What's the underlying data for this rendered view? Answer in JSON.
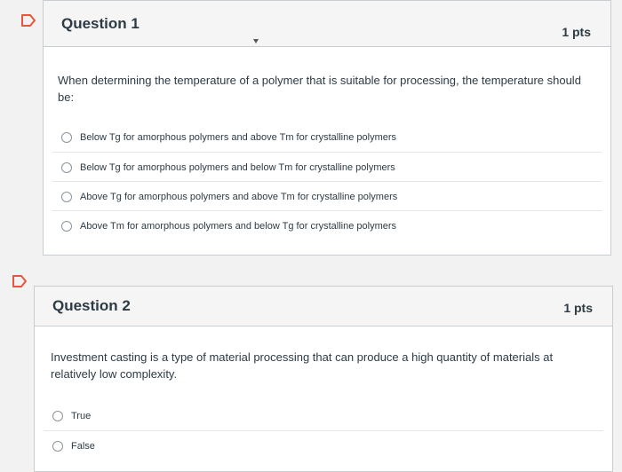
{
  "questions": [
    {
      "title": "Question 1",
      "points": "1 pts",
      "text": "When determining the temperature of a polymer that is suitable for processing, the temperature should be:",
      "answers": [
        "Below Tg for amorphous polymers and above Tm for crystalline polymers",
        "Below Tg for amorphous polymers and below Tm for crystalline polymers",
        "Above Tg for amorphous polymers and above Tm for crystalline polymers",
        "Above Tm for amorphous polymers and below Tg for crystalline polymers"
      ]
    },
    {
      "title": "Question 2",
      "points": "1 pts",
      "text": "Investment casting is a type of material processing that can produce a high quantity of materials at relatively low complexity.",
      "answers": [
        "True",
        "False"
      ]
    }
  ],
  "colors": {
    "flag": "#e4573a",
    "header_bg": "#f5f5f5",
    "border": "#c7cdd1",
    "text": "#2d3b45"
  },
  "icons": {
    "flag": "flag-icon",
    "radio": "radio-button-icon"
  }
}
